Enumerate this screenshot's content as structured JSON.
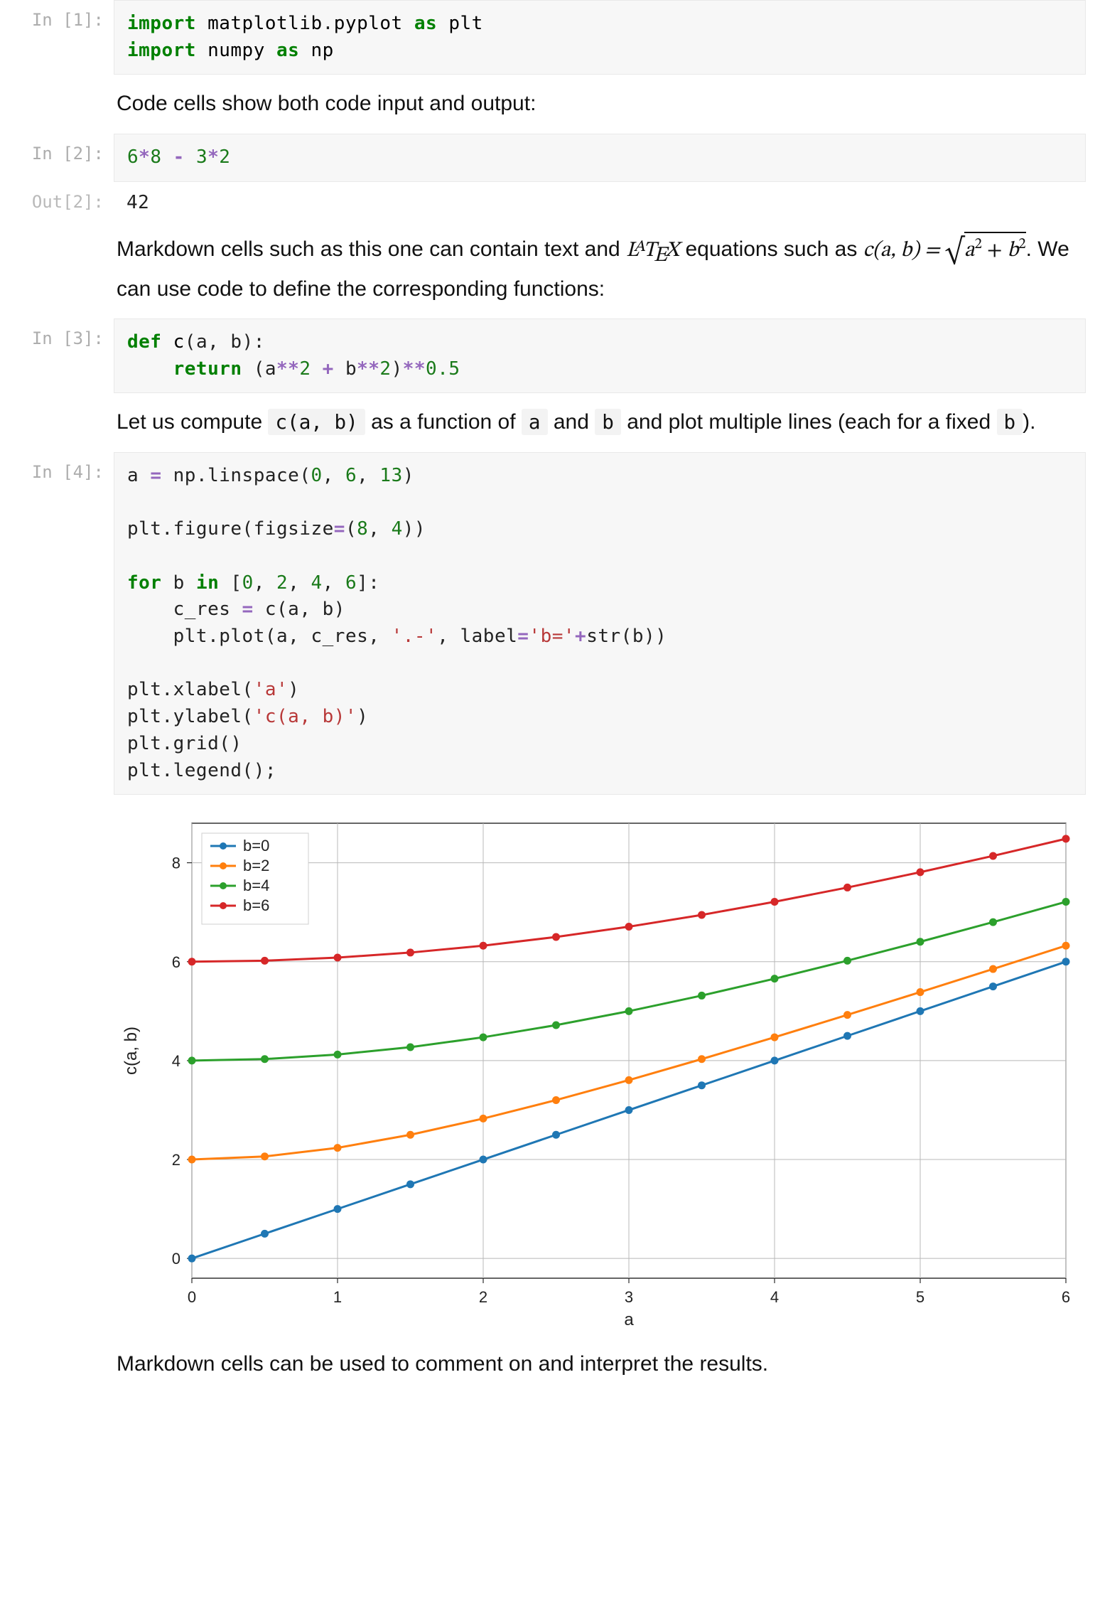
{
  "cells": {
    "c1": {
      "prompt": "In [1]:",
      "code_html": "<span class='kw'>import</span> <span class='nm'>matplotlib</span><span class='punc'>.</span><span class='nm'>pyplot</span> <span class='kw'>as</span> <span class='nm'>plt</span>\n<span class='kw'>import</span> <span class='nm'>numpy</span> <span class='kw'>as</span> <span class='nm'>np</span>"
    },
    "md1": {
      "text": "Code cells show both code input and output:"
    },
    "c2": {
      "prompt": "In [2]:",
      "code_html": "<span class='num'>6</span><span class='op'>*</span><span class='num'>8</span> <span class='op'>-</span> <span class='num'>3</span><span class='op'>*</span><span class='num'>2</span>",
      "out_prompt": "Out[2]:",
      "out_text": "42"
    },
    "md2": {
      "pre": "Markdown cells such as this one can contain text and ",
      "latex_brand": "LᴬTₑX",
      "mid1": " equations such as ",
      "eq_lhs": "c(a, b) = ",
      "eq_rhs_plain": "a² + b²",
      "mid2": ". We can use code to define the corresponding functions:"
    },
    "c3": {
      "prompt": "In [3]:",
      "code_html": "<span class='kw'>def</span> <span class='fn'>c</span><span class='punc'>(</span>a<span class='punc'>,</span> b<span class='punc'>)</span><span class='punc'>:</span>\n    <span class='kw'>return</span> <span class='punc'>(</span>a<span class='op'>**</span><span class='num'>2</span> <span class='op'>+</span> b<span class='op'>**</span><span class='num'>2</span><span class='punc'>)</span><span class='op'>**</span><span class='num'>0.5</span>"
    },
    "md3": {
      "pre": "Let us compute ",
      "code1": "c(a, b)",
      "mid1": " as a function of ",
      "code2": "a",
      "mid2": " and ",
      "code3": "b",
      "mid3": " and plot multiple lines (each for a fixed ",
      "code4": "b",
      "post": ")."
    },
    "c4": {
      "prompt": "In [4]:",
      "code_html": "a <span class='op'>=</span> np<span class='punc'>.</span>linspace<span class='punc'>(</span><span class='num'>0</span><span class='punc'>,</span> <span class='num'>6</span><span class='punc'>,</span> <span class='num'>13</span><span class='punc'>)</span>\n\nplt<span class='punc'>.</span>figure<span class='punc'>(</span>figsize<span class='op'>=</span><span class='punc'>(</span><span class='num'>8</span><span class='punc'>,</span> <span class='num'>4</span><span class='punc'>))</span>\n\n<span class='kw'>for</span> b <span class='kw'>in</span> <span class='punc'>[</span><span class='num'>0</span><span class='punc'>,</span> <span class='num'>2</span><span class='punc'>,</span> <span class='num'>4</span><span class='punc'>,</span> <span class='num'>6</span><span class='punc'>]</span><span class='punc'>:</span>\n    c_res <span class='op'>=</span> c<span class='punc'>(</span>a<span class='punc'>,</span> b<span class='punc'>)</span>\n    plt<span class='punc'>.</span>plot<span class='punc'>(</span>a<span class='punc'>,</span> c_res<span class='punc'>,</span> <span class='str'>'.-'</span><span class='punc'>,</span> label<span class='op'>=</span><span class='str'>'b='</span><span class='op'>+</span>str<span class='punc'>(</span>b<span class='punc'>))</span>\n\nplt<span class='punc'>.</span>xlabel<span class='punc'>(</span><span class='str'>'a'</span><span class='punc'>)</span>\nplt<span class='punc'>.</span>ylabel<span class='punc'>(</span><span class='str'>'c(a, b)'</span><span class='punc'>)</span>\nplt<span class='punc'>.</span>grid<span class='punc'>()</span>\nplt<span class='punc'>.</span>legend<span class='punc'>()</span><span class='punc'>;</span>"
    },
    "md4": {
      "text": "Markdown cells can be used to comment on and interpret the results."
    }
  },
  "chart_data": {
    "type": "line",
    "xlabel": "a",
    "ylabel": "c(a, b)",
    "xlim": [
      0,
      6
    ],
    "ylim": [
      -0.4,
      8.8
    ],
    "xticks": [
      0,
      1,
      2,
      3,
      4,
      5,
      6
    ],
    "yticks": [
      0,
      2,
      4,
      6,
      8
    ],
    "grid": true,
    "legend_position": "upper-left",
    "x": [
      0,
      0.5,
      1.0,
      1.5,
      2.0,
      2.5,
      3.0,
      3.5,
      4.0,
      4.5,
      5.0,
      5.5,
      6.0
    ],
    "series": [
      {
        "name": "b=0",
        "color": "#1f77b4",
        "values": [
          0.0,
          0.5,
          1.0,
          1.5,
          2.0,
          2.5,
          3.0,
          3.5,
          4.0,
          4.5,
          5.0,
          5.5,
          6.0
        ]
      },
      {
        "name": "b=2",
        "color": "#ff7f0e",
        "values": [
          2.0,
          2.0616,
          2.2361,
          2.5,
          2.8284,
          3.2016,
          3.6056,
          4.0311,
          4.4721,
          4.9244,
          5.3852,
          5.8523,
          6.3246
        ]
      },
      {
        "name": "b=4",
        "color": "#2ca02c",
        "values": [
          4.0,
          4.0311,
          4.1231,
          4.272,
          4.4721,
          4.717,
          5.0,
          5.3151,
          5.6569,
          6.0208,
          6.4031,
          6.8007,
          7.2111
        ]
      },
      {
        "name": "b=6",
        "color": "#d62728",
        "values": [
          6.0,
          6.0208,
          6.0828,
          6.1847,
          6.3246,
          6.5,
          6.7082,
          6.9462,
          7.2111,
          7.5,
          7.8102,
          8.1394,
          8.4853
        ]
      }
    ]
  }
}
